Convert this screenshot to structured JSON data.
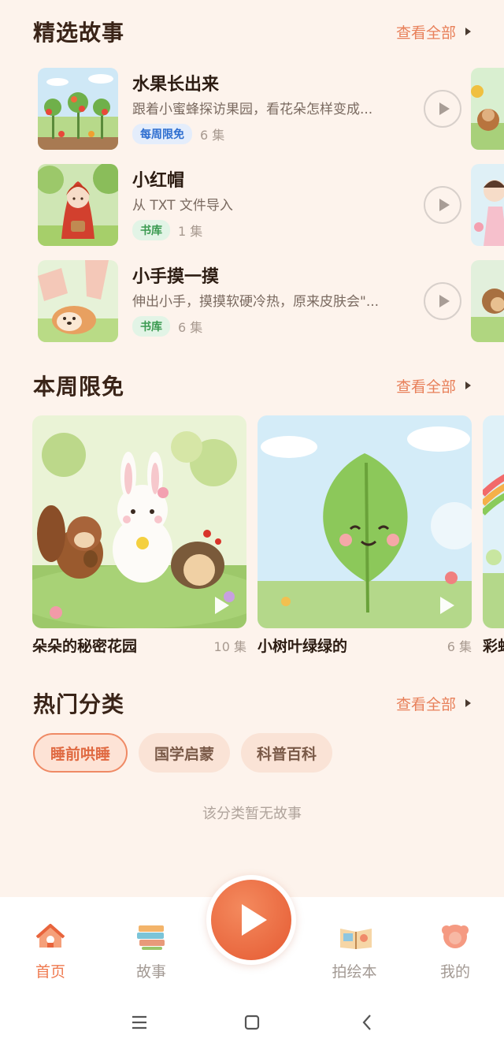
{
  "featured": {
    "title": "精选故事",
    "see_all": "查看全部",
    "stories": [
      {
        "title": "水果长出来",
        "desc": "跟着小蜜蜂探访果园，看花朵怎样变成...",
        "tag": "每周限免",
        "tag_color": "blue",
        "episodes": "6 集"
      },
      {
        "title": "小红帽",
        "desc": "从 TXT 文件导入",
        "tag": "书库",
        "tag_color": "green",
        "episodes": "1 集"
      },
      {
        "title": "小手摸一摸",
        "desc": "伸出小手，摸摸软硬冷热，原来皮肤会\"...",
        "tag": "书库",
        "tag_color": "green",
        "episodes": "6 集"
      }
    ]
  },
  "weekly": {
    "title": "本周限免",
    "see_all": "查看全部",
    "cards": [
      {
        "title": "朵朵的秘密花园",
        "episodes": "10 集"
      },
      {
        "title": "小树叶绿绿的",
        "episodes": "6 集"
      },
      {
        "title": "彩虹"
      }
    ]
  },
  "categories": {
    "title": "热门分类",
    "see_all": "查看全部",
    "chips": [
      "睡前哄睡",
      "国学启蒙",
      "科普百科"
    ],
    "active_index": 0,
    "empty_text": "该分类暂无故事"
  },
  "nav": {
    "items": [
      {
        "label": "首页",
        "icon": "home-icon",
        "active": true
      },
      {
        "label": "故事",
        "icon": "books-icon",
        "active": false
      },
      {
        "label": "拍绘本",
        "icon": "picture-book-icon",
        "active": false
      },
      {
        "label": "我的",
        "icon": "profile-icon",
        "active": false
      }
    ]
  },
  "colors": {
    "background": "#fdf3ec",
    "accent": "#ef7a50",
    "tag_blue": "#2f6fd0",
    "tag_green": "#3a9a50"
  }
}
